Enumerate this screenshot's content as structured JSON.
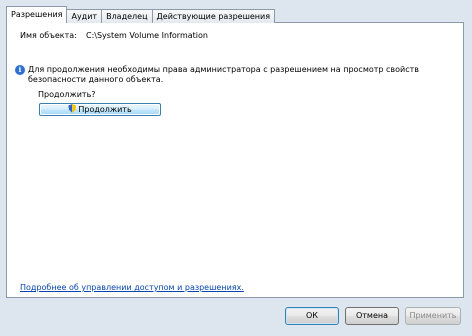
{
  "tabs": [
    "Разрешения",
    "Аудит",
    "Владелец",
    "Действующие разрешения"
  ],
  "object": {
    "label": "Имя объекта:",
    "value": "C:\\System Volume Information"
  },
  "info": {
    "text": "Для продолжения необходимы права администратора с разрешением на просмотр свойств безопасности данного объекта."
  },
  "prompt": "Продолжить?",
  "continue_button": "Продолжить",
  "help_link": "Подробнее об управлении доступом и разрешениях.",
  "buttons": {
    "ok": "ОК",
    "cancel": "Отмена",
    "apply": "Применить"
  },
  "icons": {
    "info": "info-icon",
    "shield": "uac-shield-icon"
  }
}
